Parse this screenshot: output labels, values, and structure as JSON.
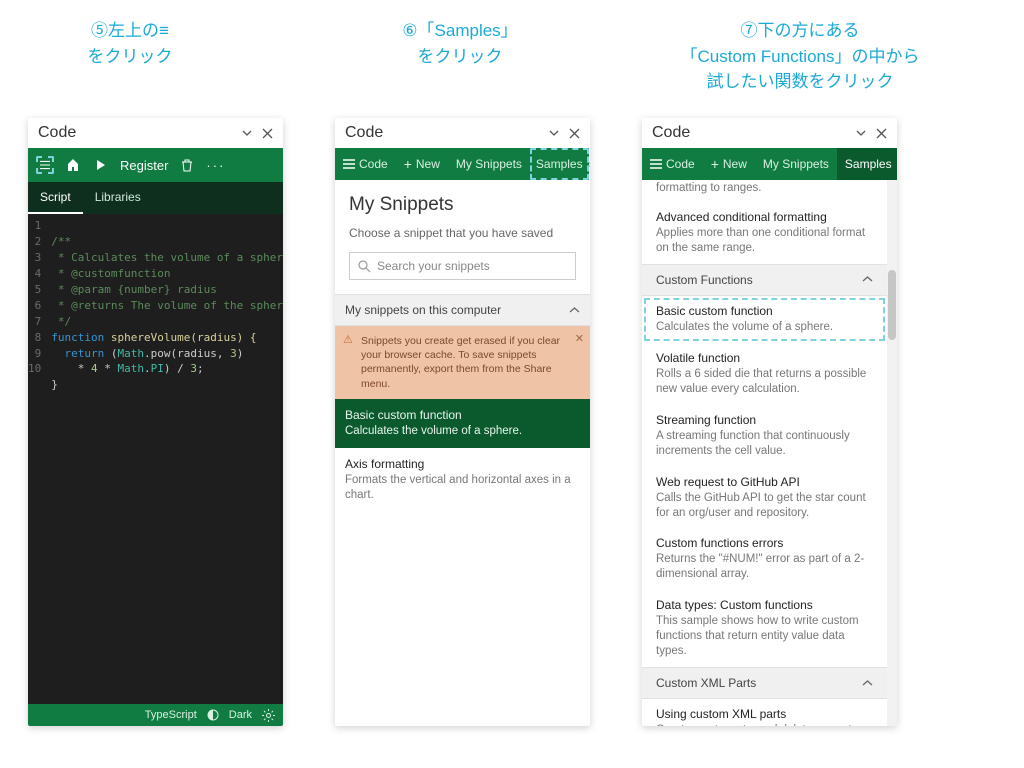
{
  "captions": {
    "c5": "⑤左上の≡\nをクリック",
    "c6": "⑥「Samples」\nをクリック",
    "c7": "⑦下の方にある\n「Custom Functions」の中から\n試したい関数をクリック"
  },
  "panelTitle": "Code",
  "panel1": {
    "toolbar": {
      "register": "Register"
    },
    "tabs": {
      "script": "Script",
      "libraries": "Libraries"
    },
    "gutters": [
      "1",
      "2",
      "3",
      "4",
      "5",
      "6",
      "7",
      "8",
      "9",
      "10"
    ],
    "code": {
      "l1": "/**",
      "l2": " * Calculates the volume of a sphere.",
      "l3": " * @customfunction",
      "l4": " * @param {number} radius",
      "l5": " * @returns The volume of the sphere.",
      "l6": " */",
      "l7a": "function",
      "l7b": " sphereVolume(radius) {",
      "l8a": "  return",
      "l8b": " (",
      "l8c": "Math",
      "l8d": ".pow(radius, ",
      "l8e": "3",
      "l8f": ")",
      "l9a": "    * ",
      "l9b": "4",
      "l9c": " * ",
      "l9d": "Math",
      "l9e": ".",
      "l9f": "PI",
      "l9g": ") / ",
      "l9h": "3",
      "l9i": ";",
      "l10": "}"
    },
    "status": {
      "lang": "TypeScript",
      "theme": "Dark"
    }
  },
  "tabsRow": {
    "code": "Code",
    "new": "New",
    "mysnippets": "My Snippets",
    "samples": "Samples"
  },
  "panel2": {
    "title": "My Snippets",
    "subtitle": "Choose a snippet that you have saved",
    "searchPlaceholder": "Search your snippets",
    "sectionHead": "My snippets on this computer",
    "warning": "Snippets you create get erased if you clear your browser cache. To save snippets permanently, export them from the Share menu.",
    "items": [
      {
        "title": "Basic custom function",
        "desc": "Calculates the volume of a sphere."
      },
      {
        "title": "Axis formatting",
        "desc": "Formats the vertical and horizontal axes in a chart."
      }
    ]
  },
  "panel3": {
    "topFragment": "formatting to ranges.",
    "preItem": {
      "title": "Advanced conditional formatting",
      "desc": "Applies more than one conditional format on the same range."
    },
    "catCustom": "Custom Functions",
    "items": [
      {
        "title": "Basic custom function",
        "desc": "Calculates the volume of a sphere."
      },
      {
        "title": "Volatile function",
        "desc": "Rolls a 6 sided die that returns a possible new value every calculation."
      },
      {
        "title": "Streaming function",
        "desc": "A streaming function that continuously increments the cell value."
      },
      {
        "title": "Web request to GitHub API",
        "desc": "Calls the GitHub API to get the star count for an org/user and repository."
      },
      {
        "title": "Custom functions errors",
        "desc": "Returns the \"#NUM!\" error as part of a 2-dimensional array."
      },
      {
        "title": "Data types: Custom functions",
        "desc": "This sample shows how to write custom functions that return entity value data types."
      }
    ],
    "catXml": "Custom XML Parts",
    "xmlItem": {
      "title": "Using custom XML parts",
      "desc": "Creates, sets, gets, and deletes a custom XML part."
    }
  }
}
